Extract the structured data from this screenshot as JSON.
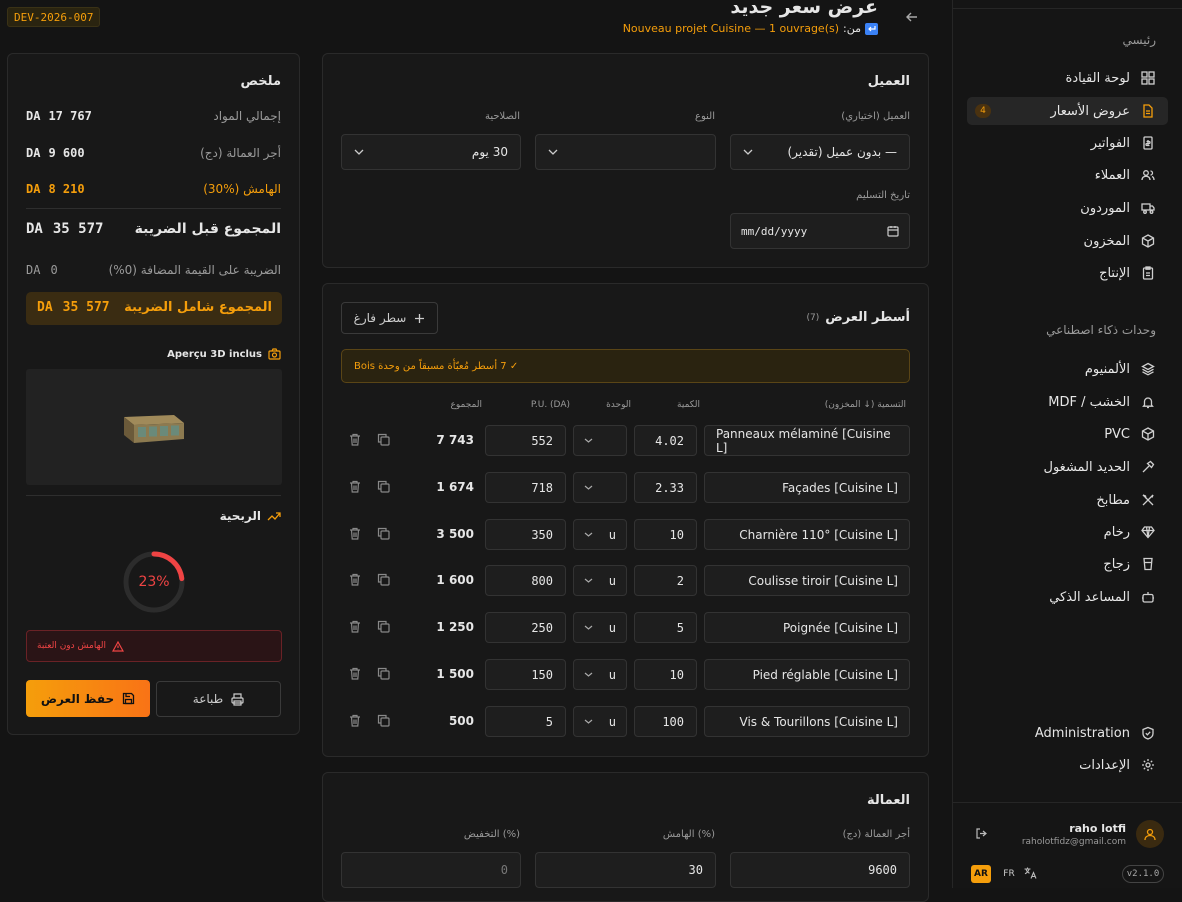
{
  "header": {
    "code": "DEV-2026-007",
    "title": "عرض سعر جديد",
    "from_label": "من:",
    "from_value": "Nouveau projet Cuisine — 1 ouvrage(s)"
  },
  "sidebar": {
    "section_main": "رئيسي",
    "items": [
      {
        "label": "لوحة القيادة",
        "icon": "grid-icon"
      },
      {
        "label": "عروض الأسعار",
        "icon": "file-icon",
        "badge": "4",
        "active": true
      },
      {
        "label": "الفواتير",
        "icon": "receipt-icon"
      },
      {
        "label": "العملاء",
        "icon": "users-icon"
      },
      {
        "label": "الموردون",
        "icon": "truck-icon"
      },
      {
        "label": "المخزون",
        "icon": "box-icon"
      },
      {
        "label": "الإنتاج",
        "icon": "clipboard-icon"
      }
    ],
    "section_ai": "وحدات ذكاء اصطناعي",
    "ai_items": [
      {
        "label": "الألمنيوم",
        "icon": "layers-icon"
      },
      {
        "label": "الخشب / MDF",
        "icon": "bell-icon"
      },
      {
        "label": "PVC",
        "icon": "box-icon"
      },
      {
        "label": "الحديد المشغول",
        "icon": "hammer-icon"
      },
      {
        "label": "مطابخ",
        "icon": "utensils-icon"
      },
      {
        "label": "رخام",
        "icon": "gem-icon"
      },
      {
        "label": "زجاج",
        "icon": "glass-icon"
      },
      {
        "label": "المساعد الذكي",
        "icon": "bot-icon"
      }
    ],
    "admin": "Administration",
    "settings": "الإعدادات",
    "user_name": "raho lotfi",
    "user_email": "raholotfidz@gmail.com",
    "lang_ar": "AR",
    "lang_fr": "FR",
    "version": "v2.1.0"
  },
  "client": {
    "section_title": "العميل",
    "client_label": "العميل (اختياري)",
    "client_value": "— بدون عميل (تقدير)",
    "type_label": "النوع",
    "type_value": "",
    "validity_label": "الصلاحية",
    "validity_value": "30 يوم",
    "delivery_label": "تاريخ التسليم",
    "delivery_placeholder": "mm/dd/yyyy"
  },
  "lines": {
    "title": "أسطر العرض",
    "count": "(7)",
    "add_label": "سطر فارغ",
    "notice": "✓ 7 أسطر مُعبّأة مسبقاً من وحدة Bois",
    "headers": {
      "designation": "التسمية (↓ المخزون)",
      "qty": "الكمية",
      "unit": "الوحدة",
      "pu": "P.U. (DA)",
      "total": "المجموع"
    },
    "rows": [
      {
        "designation": "Panneaux mélaminé [Cuisine L]",
        "qty": "4.02",
        "unit": "",
        "pu": "552",
        "total": "7 743"
      },
      {
        "designation": "Façades [Cuisine L]",
        "qty": "2.33",
        "unit": "",
        "pu": "718",
        "total": "1 674"
      },
      {
        "designation": "Charnière 110° [Cuisine L]",
        "qty": "10",
        "unit": "u",
        "pu": "350",
        "total": "3 500"
      },
      {
        "designation": "Coulisse tiroir [Cuisine L]",
        "qty": "2",
        "unit": "u",
        "pu": "800",
        "total": "1 600"
      },
      {
        "designation": "Poignée [Cuisine L]",
        "qty": "5",
        "unit": "u",
        "pu": "250",
        "total": "1 250"
      },
      {
        "designation": "Pied réglable [Cuisine L]",
        "qty": "10",
        "unit": "u",
        "pu": "150",
        "total": "1 500"
      },
      {
        "designation": "Vis & Tourillons [Cuisine L]",
        "qty": "100",
        "unit": "u",
        "pu": "5",
        "total": "500"
      }
    ]
  },
  "labor": {
    "title": "العمالة",
    "labor_label": "أجر العمالة (دج)",
    "labor_value": "9600",
    "margin_label": "الهامش (%)",
    "margin_value": "30",
    "discount_label": "التخفيض (%)",
    "discount_value": "0"
  },
  "summary": {
    "title": "ملخص",
    "materials_label": "إجمالي المواد",
    "materials_value": "17 767",
    "materials_cur": "DA",
    "labor_label": "أجر العمالة (دج)",
    "labor_value": "9 600",
    "labor_cur": "DA",
    "margin_label": "الهامش (%30)",
    "margin_value": "8 210",
    "margin_cur": "DA",
    "pretax_label": "المجموع قبل الضريبة",
    "pretax_value": "35 577",
    "pretax_cur": "DA",
    "vat_label": "الضريبة على القيمة المضافة (0%)",
    "vat_value": "0",
    "vat_cur": "DA",
    "total_label": "المجموع شامل الضريبة",
    "total_value": "35 577",
    "total_cur": "DA",
    "preview_label": "Aperçu 3D inclus",
    "profit_label": "الربحية",
    "profit_value": "23%",
    "profit_fraction": 0.23,
    "warning": "الهامش دون العتبة",
    "save_label": "حفظ العرض",
    "print_label": "طباعة"
  },
  "colors": {
    "accent": "#f59e0b",
    "danger": "#ef4444"
  }
}
